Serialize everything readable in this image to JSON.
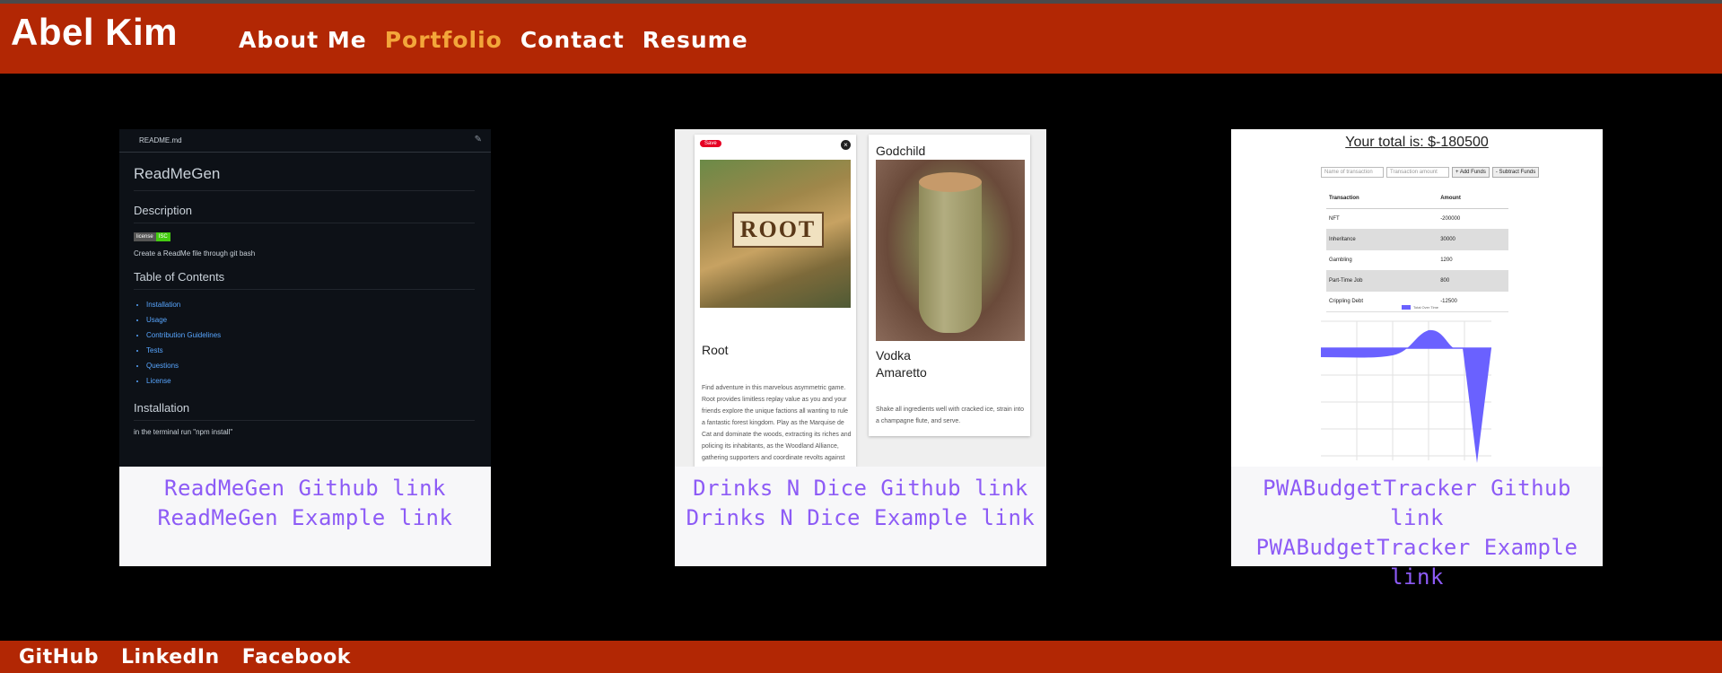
{
  "header": {
    "brand": "Abel Kim",
    "nav": [
      {
        "label": "About Me",
        "active": false
      },
      {
        "label": "Portfolio",
        "active": true
      },
      {
        "label": "Contact",
        "active": false
      },
      {
        "label": "Resume",
        "active": false
      }
    ]
  },
  "colors": {
    "bar": "#b22704",
    "active_nav": "#f3a63a",
    "link": "#8d5bf6",
    "page_bg": "#000000"
  },
  "projects": [
    {
      "github_link": "ReadMeGen Github link",
      "example_link": "ReadMeGen Example link",
      "screenshot": {
        "file": "README.md",
        "title": "ReadMeGen",
        "description_heading": "Description",
        "badge_label": "license",
        "badge_value": "ISC",
        "description": "Create a ReadMe file through git bash",
        "toc_heading": "Table of Contents",
        "toc": [
          "Installation",
          "Usage",
          "Contribution Guidelines",
          "Tests",
          "Questions",
          "License"
        ],
        "install_heading": "Installation",
        "install_text": "in the terminal run \"npm install\""
      }
    },
    {
      "github_link": "Drinks N Dice Github link",
      "example_link": "Drinks N Dice Example link",
      "screenshot": {
        "save_label": "Save",
        "game_art": "ROOT",
        "game_title": "Root",
        "game_desc": "Find adventure in this marvelous asymmetric game. Root provides limitless replay value as you and your friends explore the unique factions all wanting to rule a fantastic forest kingdom. Play as the Marquise de Cat and dominate the woods, extracting its riches and policing its inhabitants, as the Woodland Alliance, gathering supporters and coordinate revolts against",
        "drink_title": "Godchild",
        "ingredient_1": "Vodka",
        "ingredient_2": "Amaretto",
        "drink_instructions": "Shake all ingredients well with cracked ice, strain into a champagne flute, and serve."
      }
    },
    {
      "github_link": "PWABudgetTracker Github link",
      "example_link": "PWABudgetTracker Example link",
      "screenshot": {
        "total": "Your total is: $-180500",
        "name_placeholder": "Name of transaction",
        "amount_placeholder": "Transaction amount",
        "add_label": "+ Add Funds",
        "subtract_label": "- Subtract Funds",
        "col_transaction": "Transaction",
        "col_amount": "Amount",
        "rows": [
          [
            "NFT",
            "-200000"
          ],
          [
            "Inheritance",
            "30000"
          ],
          [
            "Gambling",
            "1200"
          ],
          [
            "Part-Time Job",
            "800"
          ],
          [
            "Crippling Debt",
            "-12500"
          ]
        ],
        "legend": "Total Over Time"
      }
    }
  ],
  "footer": {
    "links": [
      "GitHub",
      "LinkedIn",
      "Facebook"
    ]
  }
}
